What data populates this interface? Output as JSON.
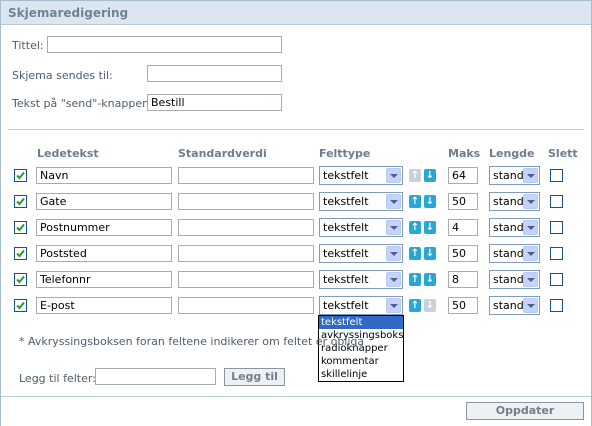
{
  "title": "Skjemaredigering",
  "settings": {
    "title_label": "Tittel:",
    "title_value": "",
    "send_to_label": "Skjema sendes til:",
    "send_to_value": "",
    "send_text_label": "Tekst på \"send\"-knappen:",
    "send_text_value": "Bestill"
  },
  "columns": {
    "label": "Ledetekst",
    "default": "Standardverdi",
    "type": "Felttype",
    "max": "Maks",
    "length": "Lengde",
    "delete": "Slett"
  },
  "rows": [
    {
      "checked": true,
      "label": "Navn",
      "default": "",
      "type": "tekstfelt",
      "max": "64",
      "length": "stand",
      "up": false,
      "down": true
    },
    {
      "checked": true,
      "label": "Gate",
      "default": "",
      "type": "tekstfelt",
      "max": "50",
      "length": "stand",
      "up": true,
      "down": true
    },
    {
      "checked": true,
      "label": "Postnummer",
      "default": "",
      "type": "tekstfelt",
      "max": "4",
      "length": "stand",
      "up": true,
      "down": true
    },
    {
      "checked": true,
      "label": "Poststed",
      "default": "",
      "type": "tekstfelt",
      "max": "50",
      "length": "stand",
      "up": true,
      "down": true
    },
    {
      "checked": true,
      "label": "Telefonnr",
      "default": "",
      "type": "tekstfelt",
      "max": "8",
      "length": "stand",
      "up": true,
      "down": true
    },
    {
      "checked": true,
      "label": "E-post",
      "default": "",
      "type": "tekstfelt",
      "max": "50",
      "length": "stand",
      "up": true,
      "down": false
    }
  ],
  "type_options": [
    "tekstfelt",
    "avkryssingsboks",
    "radioknapper",
    "kommentar",
    "skillelinje"
  ],
  "footnote": "* Avkryssingsboksen foran feltene indikerer om feltet er obliga",
  "add_fields": {
    "label": "Legg til felter:",
    "value": "",
    "button": "Legg til"
  },
  "update_button": "Oppdater",
  "colors": {
    "header_bg": "#dce6f0",
    "arrow_active": "#28a7d6",
    "arrow_inactive": "#c9d1d8",
    "dropdown_highlight": "#316ac5"
  },
  "icons": {
    "up": "arrow-up-icon",
    "down": "arrow-down-icon",
    "check": "checkmark-icon"
  }
}
